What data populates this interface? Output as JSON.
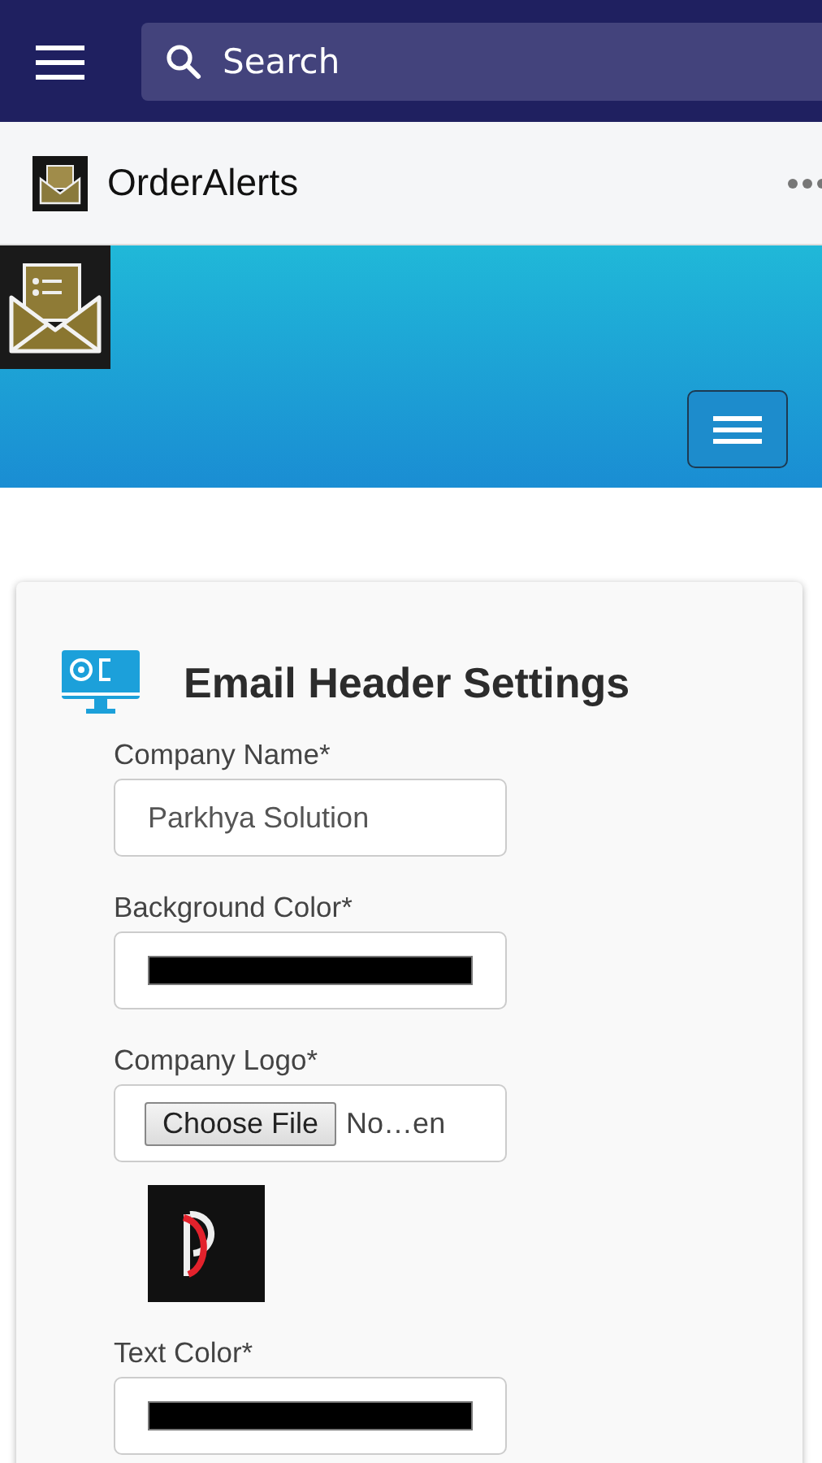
{
  "top_bar": {
    "search": {
      "placeholder": "Search"
    }
  },
  "app_header": {
    "title": "OrderAlerts"
  },
  "card": {
    "title": "Email Header Settings",
    "fields": [
      {
        "kind": "text",
        "label": "Company Name*",
        "value": "Parkhya Solution"
      },
      {
        "kind": "color",
        "label": "Background Color*",
        "color": "#000000"
      },
      {
        "kind": "file",
        "label": "Company Logo*",
        "button": "Choose File",
        "file_name": "No…en"
      },
      {
        "kind": "color",
        "label": "Text Color*",
        "color": "#000000"
      }
    ]
  }
}
